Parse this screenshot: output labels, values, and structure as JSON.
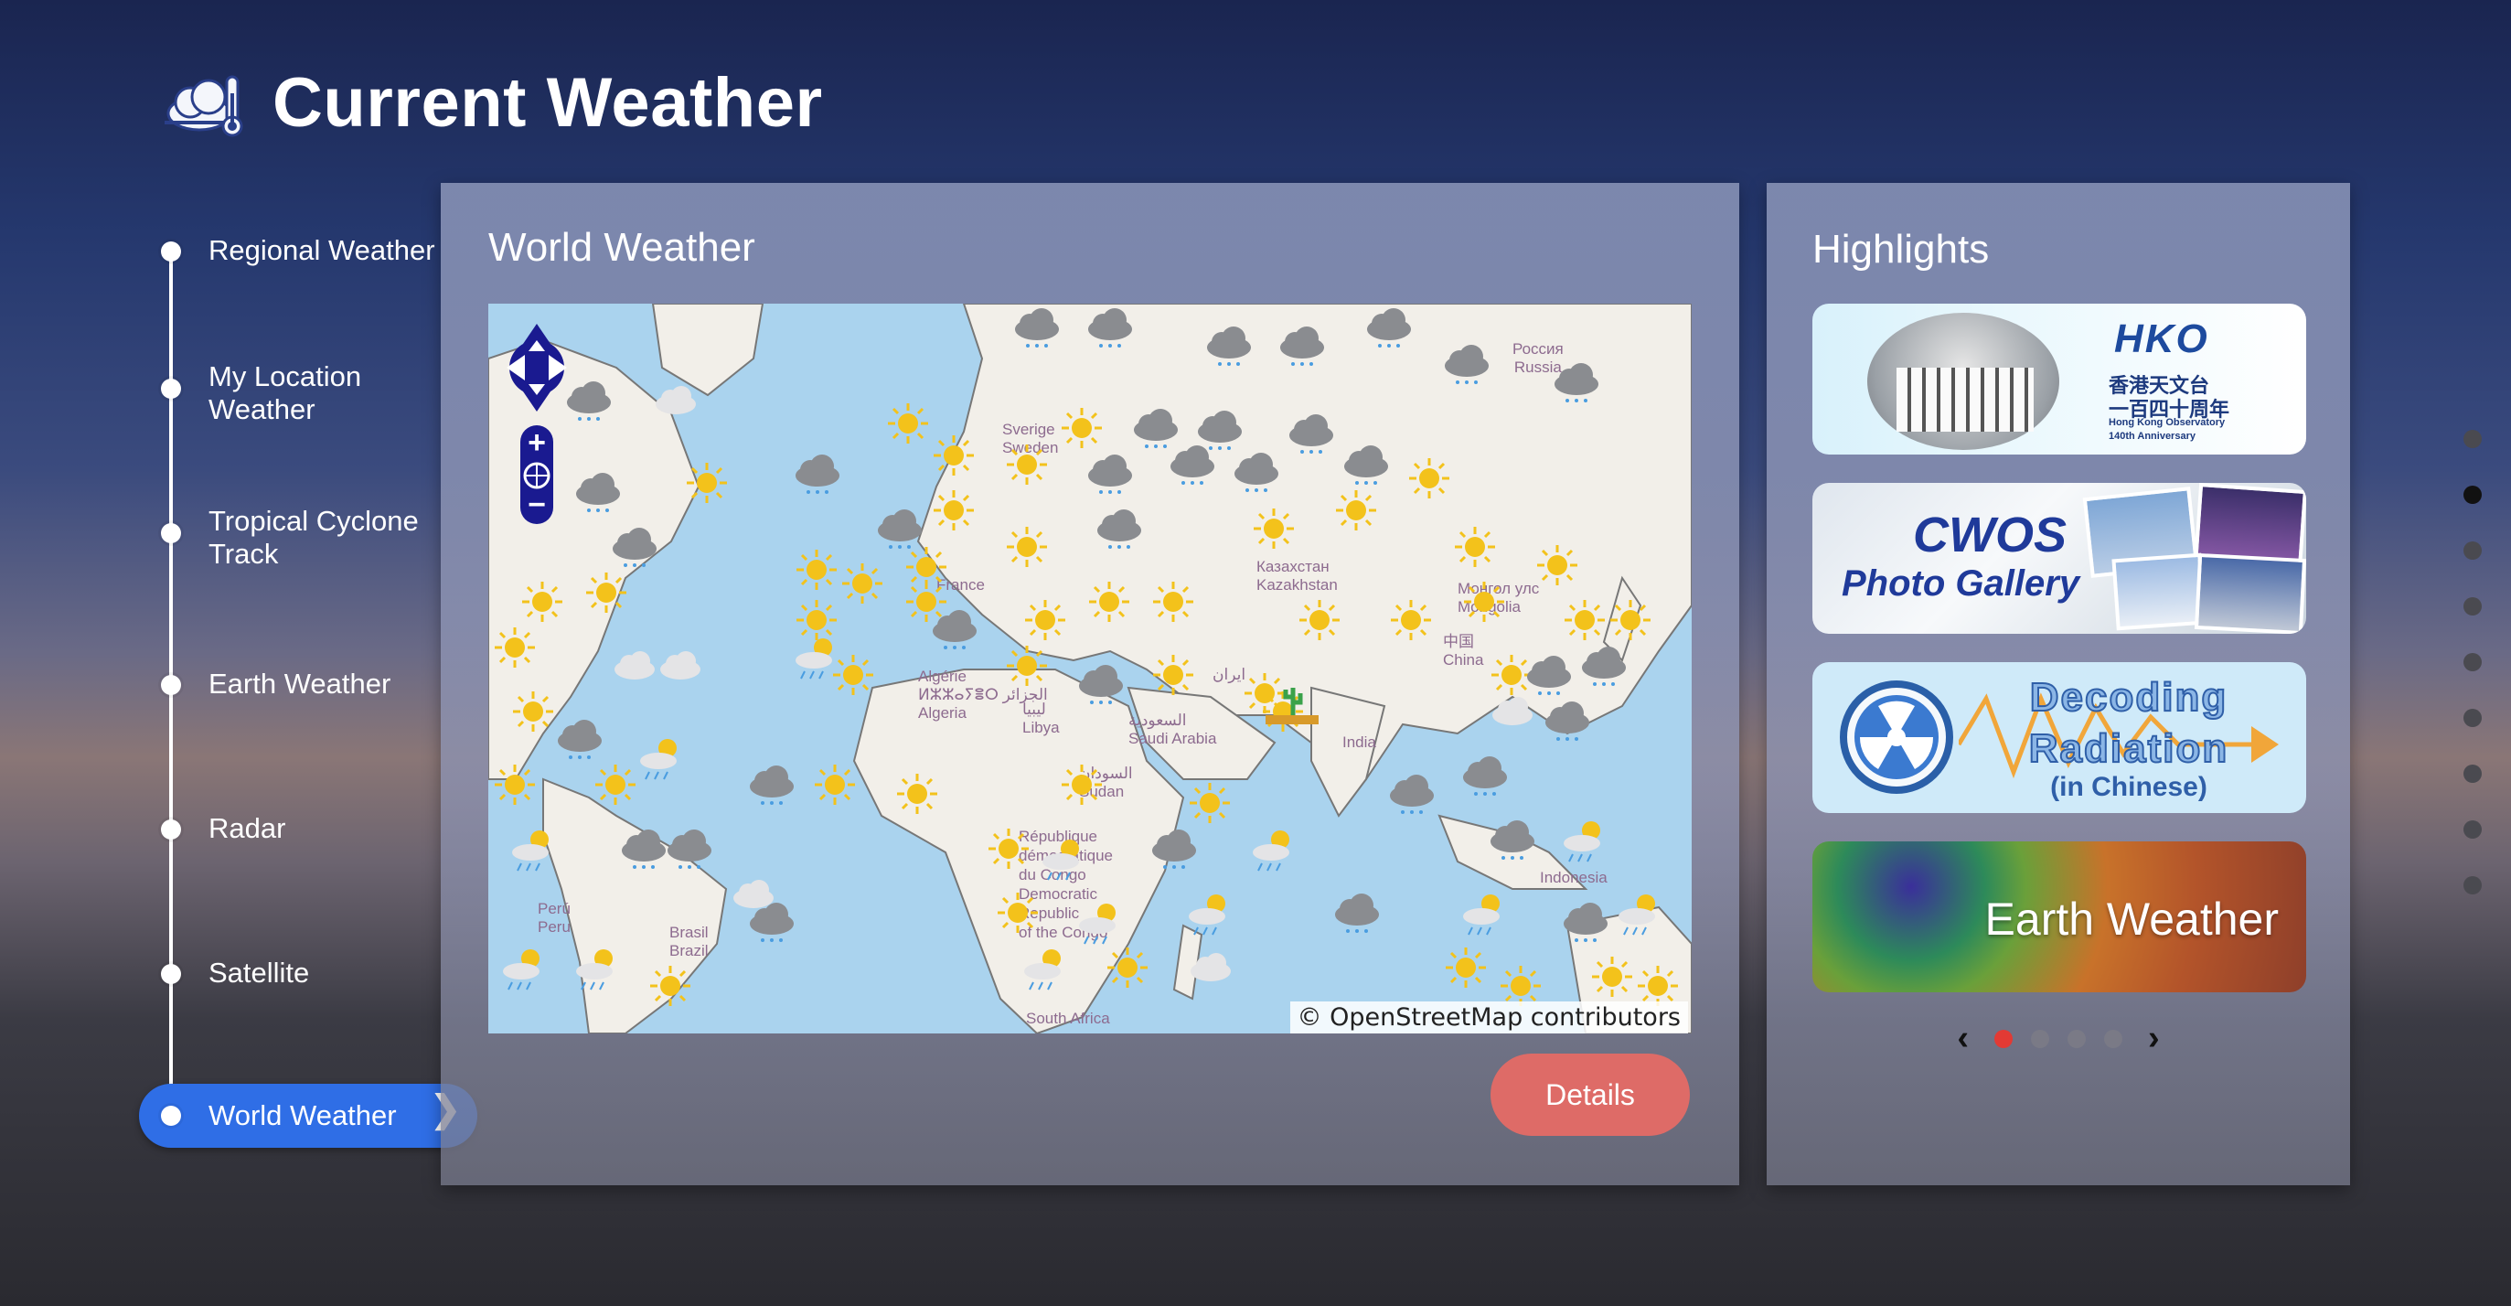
{
  "page": {
    "title": "Current Weather"
  },
  "nav": {
    "items": [
      {
        "label": "Regional Weather"
      },
      {
        "label": "My Location Weather"
      },
      {
        "label": "Tropical Cyclone Track"
      },
      {
        "label": "Earth Weather"
      },
      {
        "label": "Radar"
      },
      {
        "label": "Satellite"
      },
      {
        "label": "World Weather",
        "active": true
      }
    ],
    "active_chevron": "❯"
  },
  "world": {
    "title": "World Weather",
    "attribution": "© OpenStreetMap contributors",
    "details_label": "Details",
    "map_labels": {
      "russia_ru": "Россия",
      "russia": "Russia",
      "sweden_sv": "Sverige",
      "sweden": "Sweden",
      "france": "France",
      "kazakh_ru": "Казахстан",
      "kazakh": "Kazakhstan",
      "mongolia_mn": "Монгол улс",
      "mongolia": "Mongolia",
      "china_zh": "中国",
      "china": "China",
      "algeria_fr": "Algérie",
      "algeria_ar": "ⵍⵣⵣⴰⵢⴻⵔ الجزائر",
      "algeria": "Algeria",
      "libya_ar": "ليبيا",
      "libya": "Libya",
      "iran": "ایران",
      "saudi_ar": "السعودية",
      "saudi": "Saudi Arabia",
      "india": "India",
      "sudan_ar": "السودان",
      "sudan": "Sudan",
      "drc1": "République",
      "drc2": "démocratique",
      "drc3": "du Congo",
      "drc4": "Democratic",
      "drc5": "Republic",
      "drc6": "of the Congo",
      "peru_es": "Perú",
      "peru": "Peru",
      "brazil_pt": "Brasil",
      "brazil": "Brazil",
      "indonesia": "Indonesia",
      "south_africa": "South Africa"
    },
    "map_controls": {
      "pan": "pan-control",
      "zoom_in": "+",
      "zoom_out": "−"
    }
  },
  "highlights": {
    "title": "Highlights",
    "cards": [
      {
        "line1": "HKO",
        "line2": "香港天文台",
        "line3": "一百四十周年",
        "line4": "Hong Kong Observatory",
        "line5": "140th Anniversary"
      },
      {
        "line1": "CWOS",
        "line2": "Photo Gallery"
      },
      {
        "line1": "Decoding",
        "line2": "Radiation",
        "line3": "(in Chinese)"
      },
      {
        "line1": "Earth Weather"
      }
    ],
    "carousel": {
      "prev": "‹",
      "next": "›",
      "count": 5,
      "active": 0
    }
  },
  "pager": {
    "count": 9,
    "active": 1
  },
  "colors": {
    "nav_active": "#2f6ee6",
    "details_button": "#de6b67",
    "carousel_active": "#e23a34"
  },
  "icons": {
    "title_icon": "cloud-thermometer-icon",
    "weather": [
      "sunny-icon",
      "cloudy-icon",
      "rain-icon",
      "sunny-rain-icon",
      "partly-cloudy-icon",
      "desert-icon"
    ]
  }
}
